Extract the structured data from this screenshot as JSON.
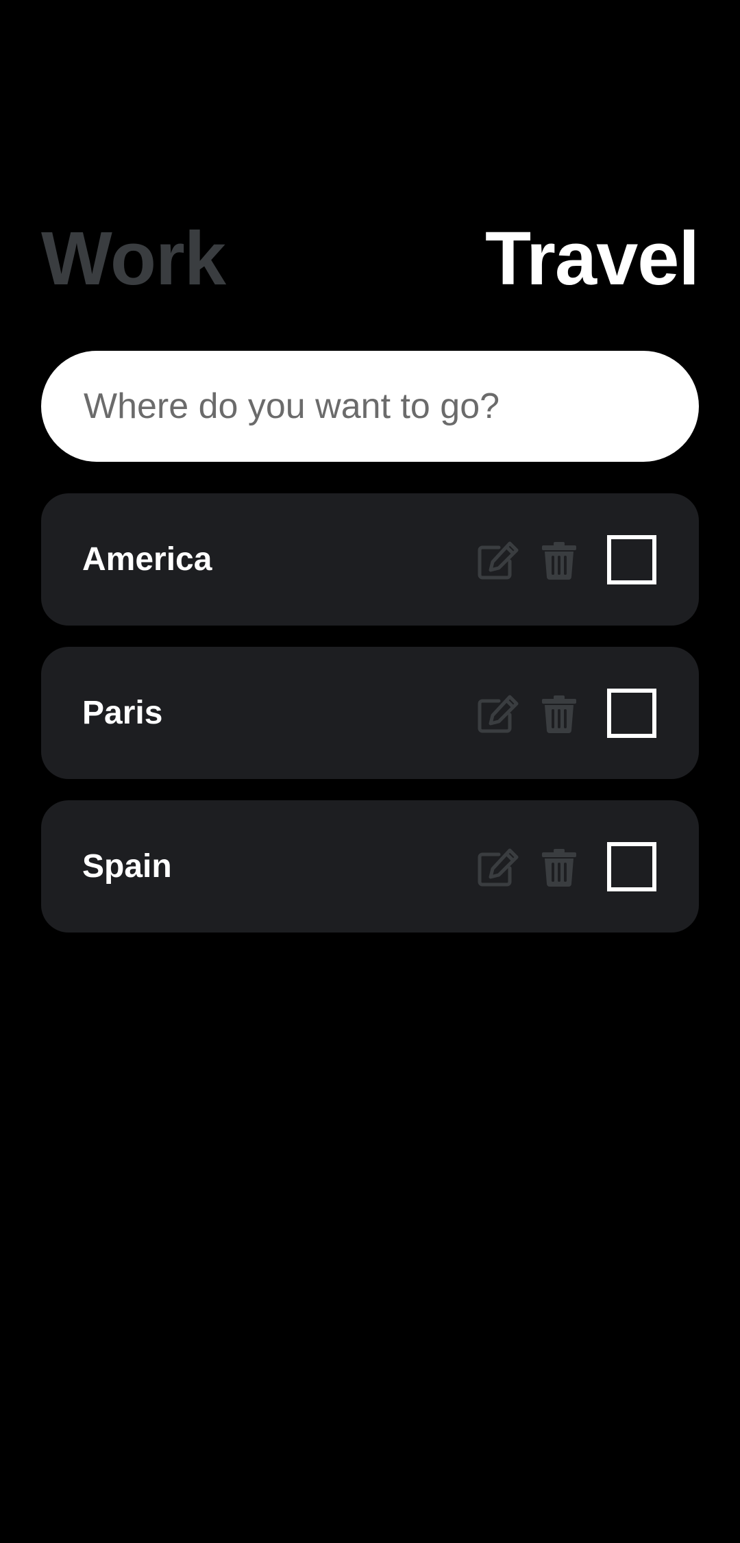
{
  "tabs": {
    "work_label": "Work",
    "travel_label": "Travel",
    "active": "travel"
  },
  "search": {
    "placeholder": "Where do you want to go?",
    "value": ""
  },
  "items": [
    {
      "label": "America",
      "checked": false
    },
    {
      "label": "Paris",
      "checked": false
    },
    {
      "label": "Spain",
      "checked": false
    }
  ],
  "colors": {
    "background": "#000000",
    "card": "#1d1e21",
    "inactive_tab": "#3a3d40",
    "active_tab": "#ffffff",
    "icon": "#3a3d40"
  },
  "icons": {
    "edit": "edit-icon",
    "delete": "trash-icon"
  }
}
